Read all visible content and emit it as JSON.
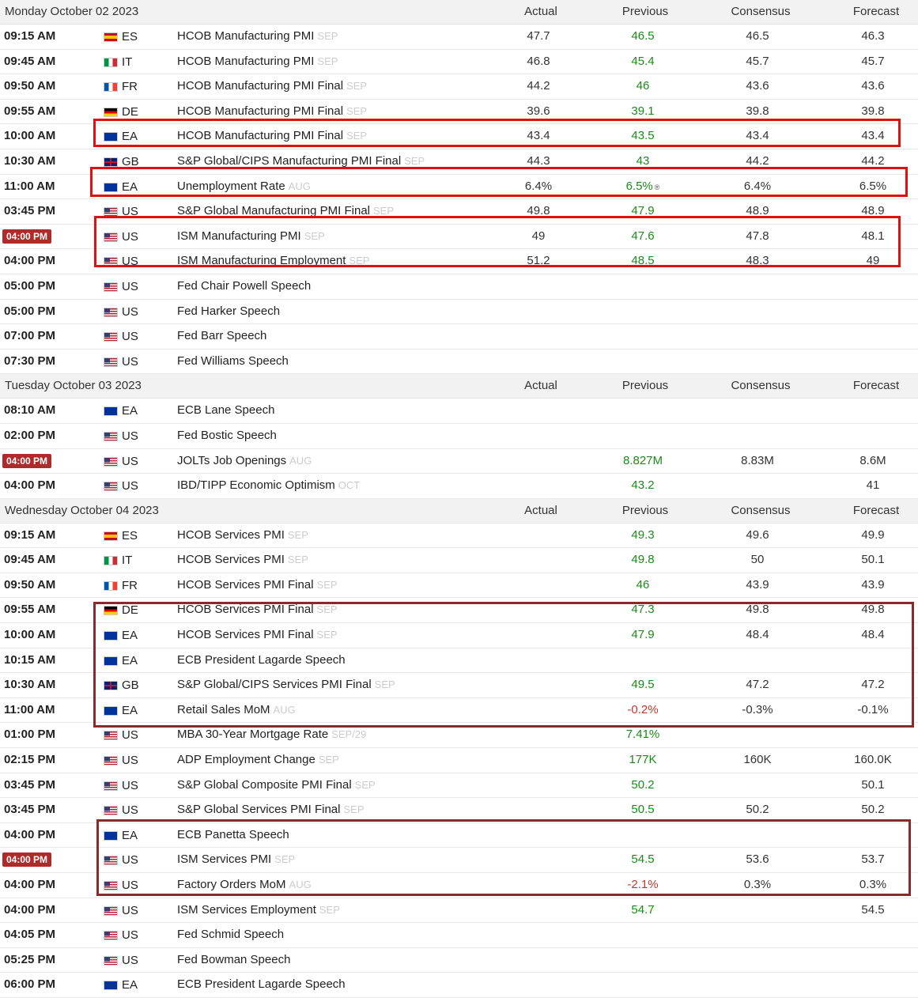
{
  "columns": {
    "actual": "Actual",
    "previous": "Previous",
    "consensus": "Consensus",
    "forecast": "Forecast"
  },
  "days": [
    {
      "title": "Monday October 02 2023",
      "events": [
        {
          "time": "09:15 AM",
          "country": "ES",
          "event": "HCOB Manufacturing PMI",
          "period": "SEP",
          "actual": "47.7",
          "previous": "46.5",
          "consensus": "46.5",
          "forecast": "46.3"
        },
        {
          "time": "09:45 AM",
          "country": "IT",
          "event": "HCOB Manufacturing PMI",
          "period": "SEP",
          "actual": "46.8",
          "previous": "45.4",
          "consensus": "45.7",
          "forecast": "45.7"
        },
        {
          "time": "09:50 AM",
          "country": "FR",
          "event": "HCOB Manufacturing PMI Final",
          "period": "SEP",
          "actual": "44.2",
          "previous": "46",
          "consensus": "43.6",
          "forecast": "43.6"
        },
        {
          "time": "09:55 AM",
          "country": "DE",
          "event": "HCOB Manufacturing PMI Final",
          "period": "SEP",
          "actual": "39.6",
          "previous": "39.1",
          "consensus": "39.8",
          "forecast": "39.8"
        },
        {
          "time": "10:00 AM",
          "country": "EA",
          "event": "HCOB Manufacturing PMI Final",
          "period": "SEP",
          "actual": "43.4",
          "previous": "43.5",
          "consensus": "43.4",
          "forecast": "43.4"
        },
        {
          "time": "10:30 AM",
          "country": "GB",
          "event": "S&P Global/CIPS Manufacturing PMI Final",
          "period": "SEP",
          "actual": "44.3",
          "previous": "43",
          "consensus": "44.2",
          "forecast": "44.2"
        },
        {
          "time": "11:00 AM",
          "country": "EA",
          "event": "Unemployment Rate",
          "period": "AUG",
          "actual": "6.4%",
          "previous": "6.5%",
          "revised": "®",
          "consensus": "6.4%",
          "forecast": "6.5%"
        },
        {
          "time": "03:45 PM",
          "country": "US",
          "event": "S&P Global Manufacturing PMI Final",
          "period": "SEP",
          "actual": "49.8",
          "previous": "47.9",
          "consensus": "48.9",
          "forecast": "48.9"
        },
        {
          "time": "04:00 PM",
          "highlight": true,
          "country": "US",
          "event": "ISM Manufacturing PMI",
          "period": "SEP",
          "actual": "49",
          "previous": "47.6",
          "consensus": "47.8",
          "forecast": "48.1"
        },
        {
          "time": "04:00 PM",
          "country": "US",
          "event": "ISM Manufacturing Employment",
          "period": "SEP",
          "actual": "51.2",
          "previous": "48.5",
          "consensus": "48.3",
          "forecast": "49"
        },
        {
          "time": "05:00 PM",
          "country": "US",
          "event": "Fed Chair Powell Speech",
          "period": "",
          "actual": "",
          "previous": "",
          "consensus": "",
          "forecast": ""
        },
        {
          "time": "05:00 PM",
          "country": "US",
          "event": "Fed Harker Speech",
          "period": "",
          "actual": "",
          "previous": "",
          "consensus": "",
          "forecast": ""
        },
        {
          "time": "07:00 PM",
          "country": "US",
          "event": "Fed Barr Speech",
          "period": "",
          "actual": "",
          "previous": "",
          "consensus": "",
          "forecast": ""
        },
        {
          "time": "07:30 PM",
          "country": "US",
          "event": "Fed Williams Speech",
          "period": "",
          "actual": "",
          "previous": "",
          "consensus": "",
          "forecast": ""
        }
      ]
    },
    {
      "title": "Tuesday October 03 2023",
      "events": [
        {
          "time": "08:10 AM",
          "country": "EA",
          "event": "ECB Lane Speech",
          "period": "",
          "actual": "",
          "previous": "",
          "consensus": "",
          "forecast": ""
        },
        {
          "time": "02:00 PM",
          "country": "US",
          "event": "Fed Bostic Speech",
          "period": "",
          "actual": "",
          "previous": "",
          "consensus": "",
          "forecast": ""
        },
        {
          "time": "04:00 PM",
          "highlight": true,
          "country": "US",
          "event": "JOLTs Job Openings",
          "period": "AUG",
          "actual": "",
          "previous": "8.827M",
          "consensus": "8.83M",
          "forecast": "8.6M"
        },
        {
          "time": "04:00 PM",
          "country": "US",
          "event": "IBD/TIPP Economic Optimism",
          "period": "OCT",
          "actual": "",
          "previous": "43.2",
          "consensus": "",
          "forecast": "41"
        }
      ]
    },
    {
      "title": "Wednesday October 04 2023",
      "events": [
        {
          "time": "09:15 AM",
          "country": "ES",
          "event": "HCOB Services PMI",
          "period": "SEP",
          "actual": "",
          "previous": "49.3",
          "consensus": "49.6",
          "forecast": "49.9"
        },
        {
          "time": "09:45 AM",
          "country": "IT",
          "event": "HCOB Services PMI",
          "period": "SEP",
          "actual": "",
          "previous": "49.8",
          "consensus": "50",
          "forecast": "50.1"
        },
        {
          "time": "09:50 AM",
          "country": "FR",
          "event": "HCOB Services PMI Final",
          "period": "SEP",
          "actual": "",
          "previous": "46",
          "consensus": "43.9",
          "forecast": "43.9"
        },
        {
          "time": "09:55 AM",
          "country": "DE",
          "event": "HCOB Services PMI Final",
          "period": "SEP",
          "actual": "",
          "previous": "47.3",
          "consensus": "49.8",
          "forecast": "49.8"
        },
        {
          "time": "10:00 AM",
          "country": "EA",
          "event": "HCOB Services PMI Final",
          "period": "SEP",
          "actual": "",
          "previous": "47.9",
          "consensus": "48.4",
          "forecast": "48.4"
        },
        {
          "time": "10:15 AM",
          "country": "EA",
          "event": "ECB President Lagarde Speech",
          "period": "",
          "actual": "",
          "previous": "",
          "consensus": "",
          "forecast": ""
        },
        {
          "time": "10:30 AM",
          "country": "GB",
          "event": "S&P Global/CIPS Services PMI Final",
          "period": "SEP",
          "actual": "",
          "previous": "49.5",
          "consensus": "47.2",
          "forecast": "47.2"
        },
        {
          "time": "11:00 AM",
          "country": "EA",
          "event": "Retail Sales MoM",
          "period": "AUG",
          "actual": "",
          "previous": "-0.2%",
          "prevColor": "red",
          "consensus": "-0.3%",
          "forecast": "-0.1%"
        },
        {
          "time": "01:00 PM",
          "country": "US",
          "event": "MBA 30-Year Mortgage Rate",
          "period": "SEP/29",
          "actual": "",
          "previous": "7.41%",
          "consensus": "",
          "forecast": ""
        },
        {
          "time": "02:15 PM",
          "country": "US",
          "event": "ADP Employment Change",
          "period": "SEP",
          "actual": "",
          "previous": "177K",
          "consensus": "160K",
          "forecast": "160.0K"
        },
        {
          "time": "03:45 PM",
          "country": "US",
          "event": "S&P Global Composite PMI Final",
          "period": "SEP",
          "actual": "",
          "previous": "50.2",
          "consensus": "",
          "forecast": "50.1"
        },
        {
          "time": "03:45 PM",
          "country": "US",
          "event": "S&P Global Services PMI Final",
          "period": "SEP",
          "actual": "",
          "previous": "50.5",
          "consensus": "50.2",
          "forecast": "50.2"
        },
        {
          "time": "04:00 PM",
          "country": "EA",
          "event": "ECB Panetta Speech",
          "period": "",
          "actual": "",
          "previous": "",
          "consensus": "",
          "forecast": ""
        },
        {
          "time": "04:00 PM",
          "highlight": true,
          "country": "US",
          "event": "ISM Services PMI",
          "period": "SEP",
          "actual": "",
          "previous": "54.5",
          "consensus": "53.6",
          "forecast": "53.7"
        },
        {
          "time": "04:00 PM",
          "country": "US",
          "event": "Factory Orders MoM",
          "period": "AUG",
          "actual": "",
          "previous": "-2.1%",
          "prevColor": "red",
          "consensus": "0.3%",
          "forecast": "0.3%"
        },
        {
          "time": "04:00 PM",
          "country": "US",
          "event": "ISM Services Employment",
          "period": "SEP",
          "actual": "",
          "previous": "54.7",
          "consensus": "",
          "forecast": "54.5"
        },
        {
          "time": "04:05 PM",
          "country": "US",
          "event": "Fed Schmid Speech",
          "period": "",
          "actual": "",
          "previous": "",
          "consensus": "",
          "forecast": ""
        },
        {
          "time": "05:25 PM",
          "country": "US",
          "event": "Fed Bowman Speech",
          "period": "",
          "actual": "",
          "previous": "",
          "consensus": "",
          "forecast": ""
        },
        {
          "time": "06:00 PM",
          "country": "EA",
          "event": "ECB President Lagarde Speech",
          "period": "",
          "actual": "",
          "previous": "",
          "consensus": "",
          "forecast": ""
        }
      ]
    }
  ],
  "colors": {
    "positive": "#1a8a1a",
    "negative": "#c0392b",
    "highlight_box": "#d11111",
    "highlight_box_dark": "#8b2a2a"
  }
}
